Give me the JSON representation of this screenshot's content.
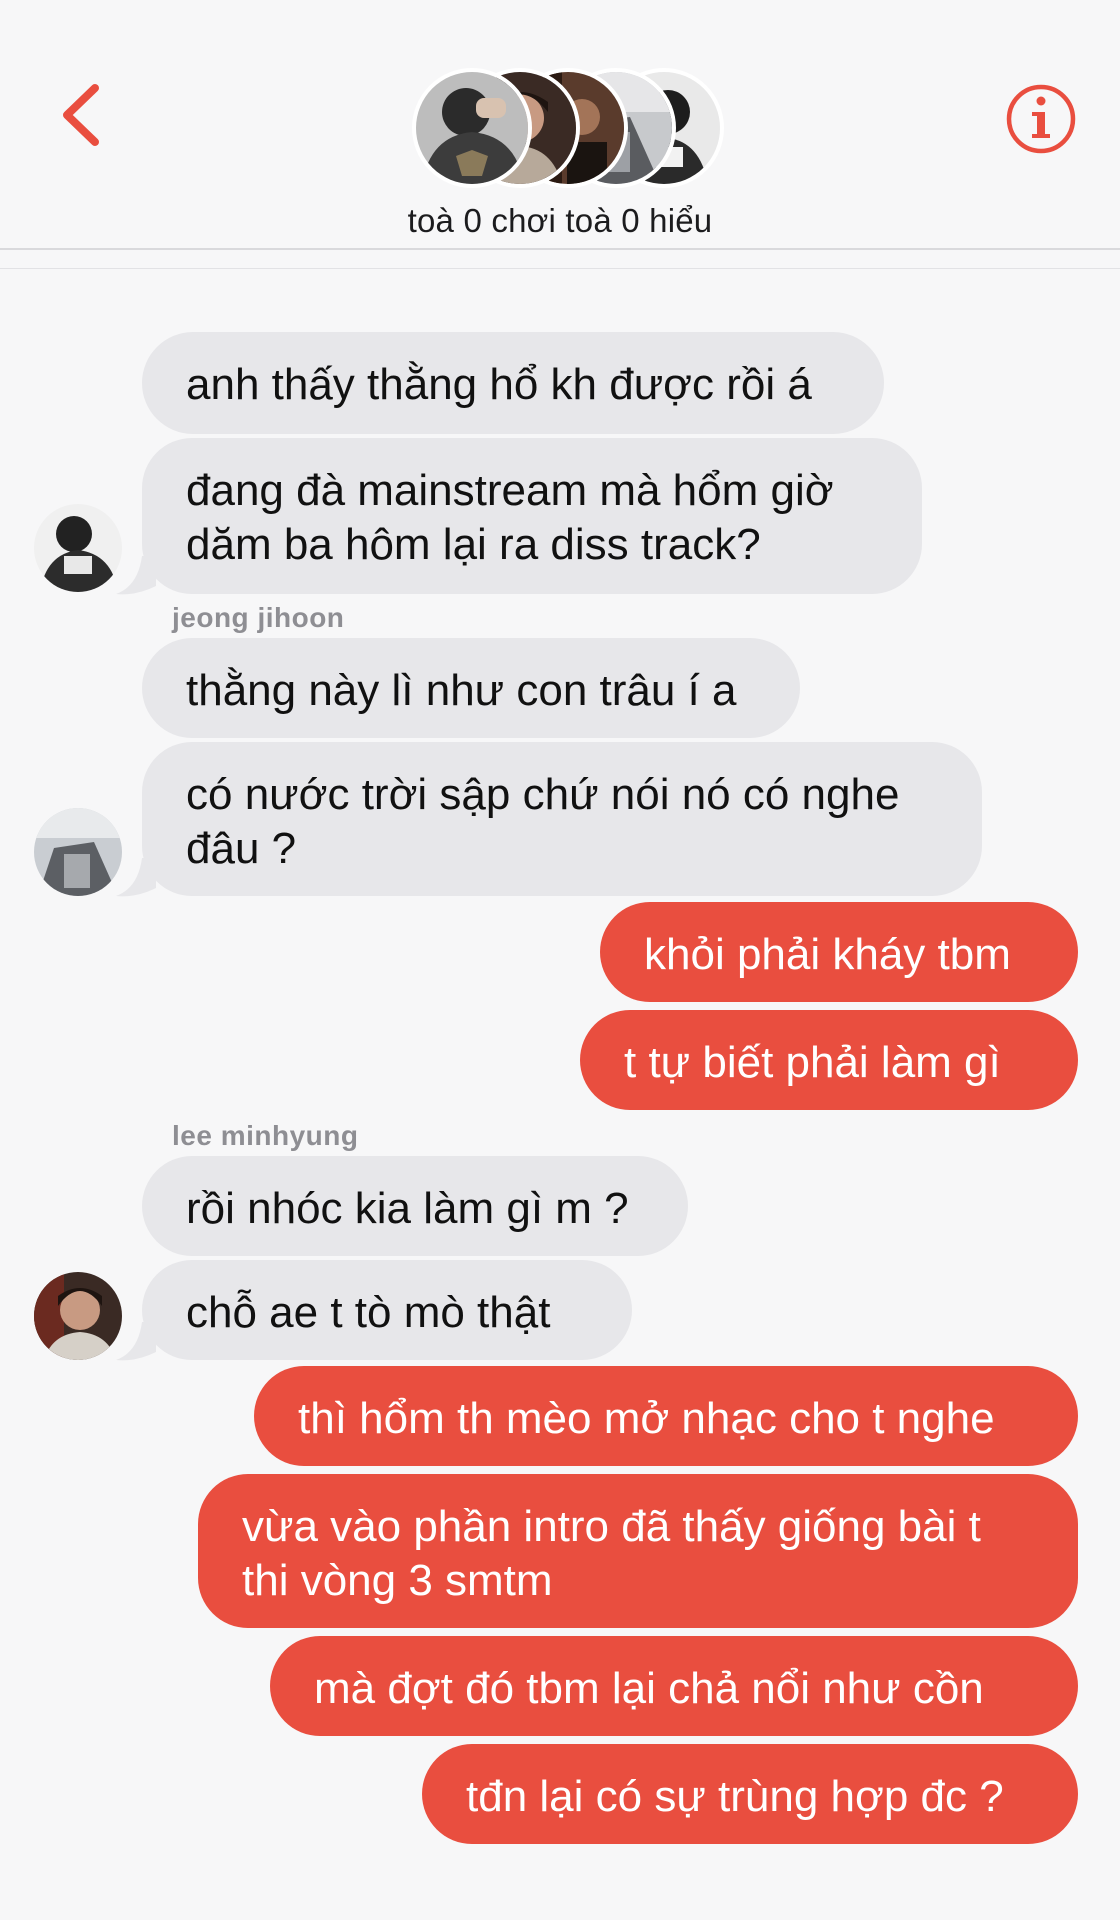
{
  "header": {
    "back_icon": "chevron-left-icon",
    "info_icon": "info-circle-icon",
    "title": "toà 0 chơi toà 0 hiểu",
    "accent": "#e94e3f"
  },
  "messages": [
    {
      "id": "m1",
      "side": "in",
      "text": "anh thấy thằng hổ kh được rồi á"
    },
    {
      "id": "m2",
      "side": "in",
      "lines": [
        "đang đà mainstream mà hổm giờ",
        "dăm ba hôm lại ra diss track?"
      ]
    },
    {
      "id": "n1",
      "sender": "jeong jihoon"
    },
    {
      "id": "m3",
      "side": "in",
      "text": "thằng này lì như con trâu í a"
    },
    {
      "id": "m4",
      "side": "in",
      "lines": [
        "có nước trời sập chứ nói nó có nghe",
        "đâu ?"
      ]
    },
    {
      "id": "m5",
      "side": "out",
      "text": "khỏi phải kháy tbm"
    },
    {
      "id": "m6",
      "side": "out",
      "text": "t tự biết phải làm gì"
    },
    {
      "id": "n2",
      "sender": "lee minhyung"
    },
    {
      "id": "m7",
      "side": "in",
      "text": "rồi nhóc kia làm gì m ?"
    },
    {
      "id": "m8",
      "side": "in",
      "text": "chỗ ae t tò mò thật"
    },
    {
      "id": "m9",
      "side": "out",
      "text": "thì hổm th mèo mở nhạc cho t nghe"
    },
    {
      "id": "m10",
      "side": "out",
      "lines": [
        "vừa vào phần intro đã thấy giống bài t",
        "thi vòng 3 smtm"
      ]
    },
    {
      "id": "m11",
      "side": "out",
      "text": "mà đợt đó tbm lại chả nổi như cồn"
    },
    {
      "id": "m12",
      "side": "out",
      "text": "tđn lại có sự trùng hợp đc ?"
    }
  ],
  "colors": {
    "incoming_bubble": "#e7e7ea",
    "outgoing_bubble": "#e94e3f",
    "background": "#f7f7f8"
  }
}
